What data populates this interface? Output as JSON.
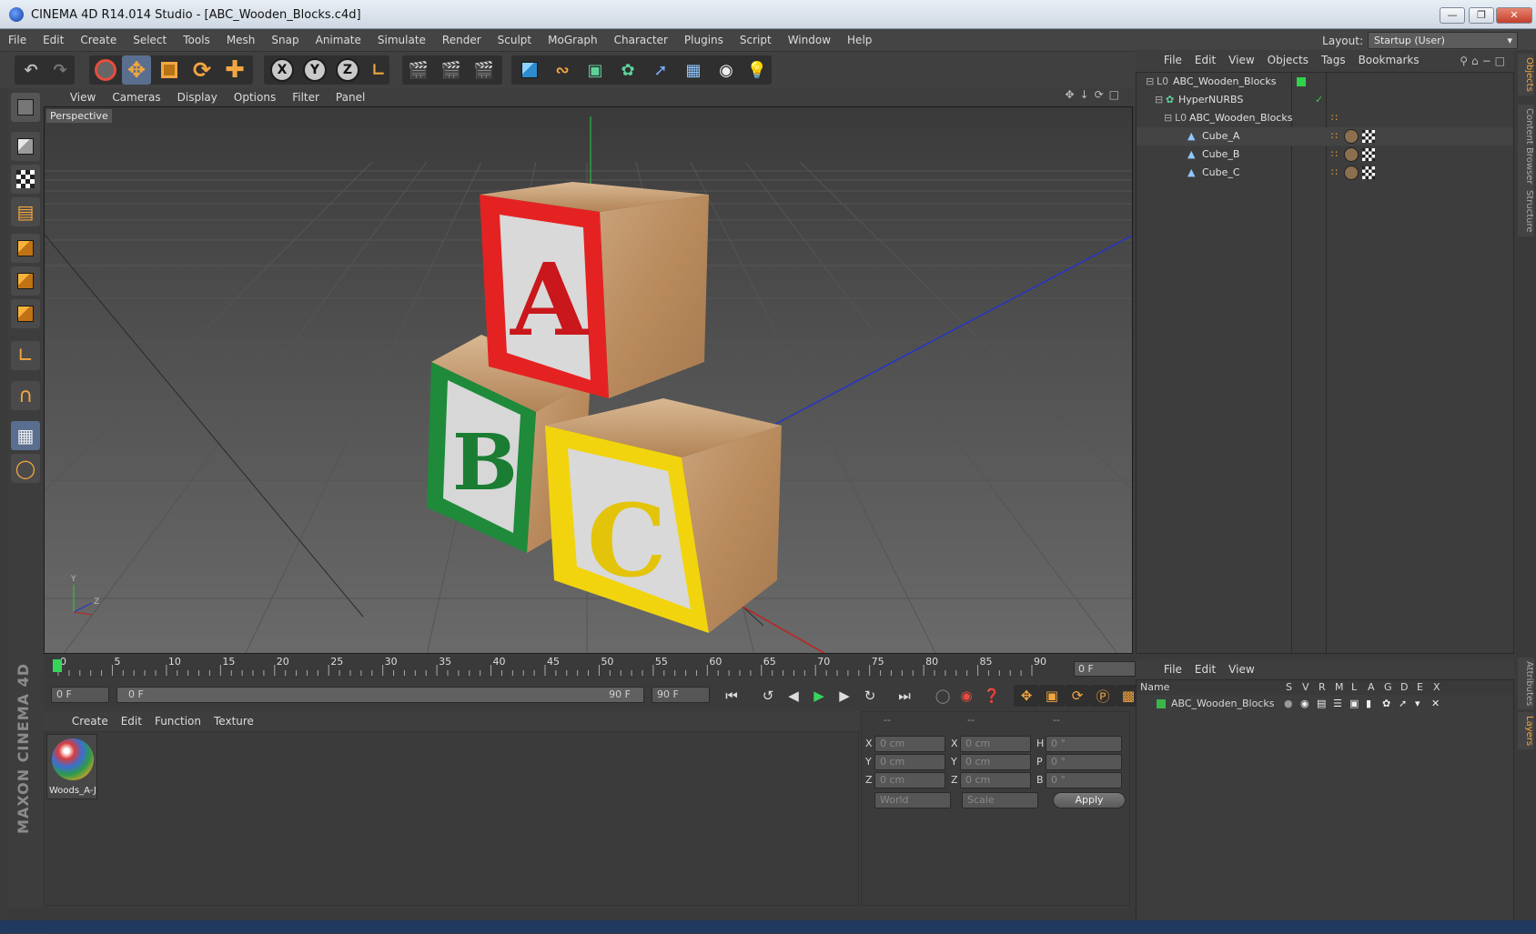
{
  "window": {
    "title": "CINEMA 4D R14.014 Studio - [ABC_Wooden_Blocks.c4d]"
  },
  "menubar": {
    "items": [
      "File",
      "Edit",
      "Create",
      "Select",
      "Tools",
      "Mesh",
      "Snap",
      "Animate",
      "Simulate",
      "Render",
      "Sculpt",
      "MoGraph",
      "Character",
      "Plugins",
      "Script",
      "Window",
      "Help"
    ],
    "layout_label": "Layout:",
    "layout_value": "Startup (User)"
  },
  "viewport": {
    "menu": [
      "View",
      "Cameras",
      "Display",
      "Options",
      "Filter",
      "Panel"
    ],
    "label": "Perspective",
    "axis_y": "Y",
    "axis_z": "Z",
    "block_letters": [
      "A",
      "B",
      "C"
    ]
  },
  "timeline": {
    "ticks": [
      "0",
      "5",
      "10",
      "15",
      "20",
      "25",
      "30",
      "35",
      "40",
      "45",
      "50",
      "55",
      "60",
      "65",
      "70",
      "75",
      "80",
      "85",
      "90"
    ],
    "frame_indicator": "0 F",
    "start": "0 F",
    "range_start": "0 F",
    "range_end": "90 F",
    "end": "90 F"
  },
  "material": {
    "menu": [
      "Create",
      "Edit",
      "Function",
      "Texture"
    ],
    "items": [
      {
        "name": "Woods_A-J"
      }
    ]
  },
  "coordinates": {
    "headers": [
      "--",
      "--",
      "--"
    ],
    "rows": [
      {
        "l1": "X",
        "v1": "0 cm",
        "l2": "X",
        "v2": "0 cm",
        "l3": "H",
        "v3": "0 °"
      },
      {
        "l1": "Y",
        "v1": "0 cm",
        "l2": "Y",
        "v2": "0 cm",
        "l3": "P",
        "v3": "0 °"
      },
      {
        "l1": "Z",
        "v1": "0 cm",
        "l2": "Z",
        "v2": "0 cm",
        "l3": "B",
        "v3": "0 °"
      }
    ],
    "mode1": "World",
    "mode2": "Scale",
    "apply": "Apply"
  },
  "objects": {
    "menu": [
      "File",
      "Edit",
      "View",
      "Objects",
      "Tags",
      "Bookmarks"
    ],
    "tree": [
      {
        "name": "ABC_Wooden_Blocks",
        "type": "null"
      },
      {
        "name": "HyperNURBS",
        "type": "nurbs"
      },
      {
        "name": "ABC_Wooden_Blocks",
        "type": "null"
      },
      {
        "name": "Cube_A",
        "type": "poly"
      },
      {
        "name": "Cube_B",
        "type": "poly"
      },
      {
        "name": "Cube_C",
        "type": "poly"
      }
    ]
  },
  "layers": {
    "menu": [
      "File",
      "Edit",
      "View"
    ],
    "columns": [
      "Name",
      "S",
      "V",
      "R",
      "M",
      "L",
      "A",
      "G",
      "D",
      "E",
      "X"
    ],
    "rows": [
      {
        "name": "ABC_Wooden_Blocks",
        "color": "#39b54a"
      }
    ]
  },
  "side_tabs": [
    "Objects",
    "Content Browser",
    "Structure",
    "Attributes",
    "Layers"
  ],
  "brand": "MAXON CINEMA 4D",
  "colors": {
    "accent": "#f4a640",
    "selection": "#5a6f8f",
    "block_red": "#e52222",
    "block_green": "#1e8a3a",
    "block_yellow": "#f2d40e"
  }
}
